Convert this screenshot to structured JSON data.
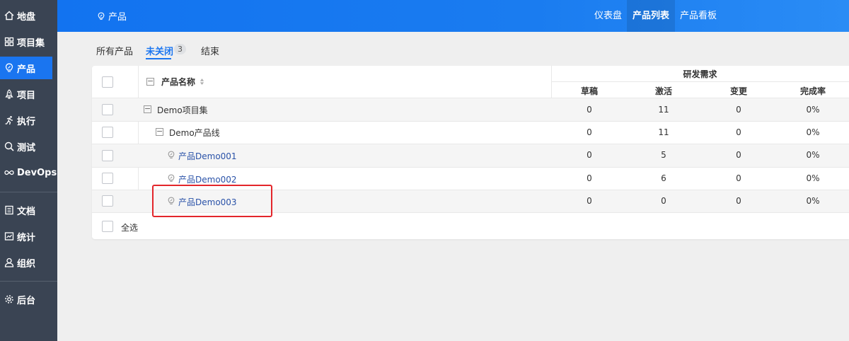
{
  "sidebar": {
    "items": [
      {
        "label": "地盘",
        "icon": "home-icon"
      },
      {
        "label": "项目集",
        "icon": "grid-icon"
      },
      {
        "label": "产品",
        "icon": "bulb-icon"
      },
      {
        "label": "项目",
        "icon": "rocket-icon"
      },
      {
        "label": "执行",
        "icon": "run-icon"
      },
      {
        "label": "测试",
        "icon": "search-icon"
      },
      {
        "label": "DevOps",
        "icon": "infinity-icon"
      },
      {
        "label": "文档",
        "icon": "document-icon"
      },
      {
        "label": "统计",
        "icon": "chart-icon"
      },
      {
        "label": "组织",
        "icon": "user-icon"
      },
      {
        "label": "后台",
        "icon": "gear-icon"
      }
    ],
    "active_index": 2
  },
  "header": {
    "title": "产品",
    "tabs": [
      "仪表盘",
      "产品列表",
      "产品看板"
    ],
    "active_tab": "产品列表"
  },
  "subtabs": {
    "all": "所有产品",
    "open": "未关闭",
    "open_count": "3",
    "closed": "结束"
  },
  "table": {
    "name_header": "产品名称",
    "group_header": "研发需求",
    "columns": [
      "草稿",
      "激活",
      "变更",
      "完成率"
    ],
    "rows": [
      {
        "name": "Demo项目集",
        "values": [
          "0",
          "11",
          "0",
          "0%"
        ]
      },
      {
        "name": "Demo产品线",
        "values": [
          "0",
          "11",
          "0",
          "0%"
        ]
      },
      {
        "name": "产品Demo001",
        "values": [
          "0",
          "5",
          "0",
          "0%"
        ]
      },
      {
        "name": "产品Demo002",
        "values": [
          "0",
          "6",
          "0",
          "0%"
        ]
      },
      {
        "name": "产品Demo003",
        "values": [
          "0",
          "0",
          "0",
          "0%"
        ]
      }
    ],
    "select_all": "全选"
  }
}
